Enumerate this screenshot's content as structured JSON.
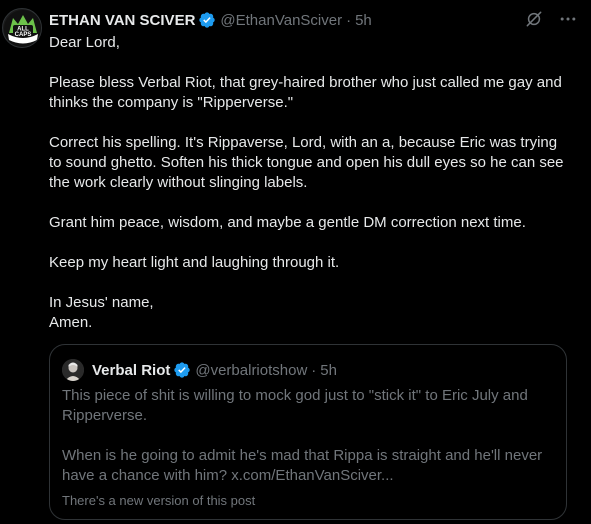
{
  "author": {
    "name": "ETHAN VAN SCIVER",
    "handle": "@EthanVanSciver",
    "separator": "·",
    "time": "5h",
    "avatar_icon": "all-caps-logo",
    "avatar_logo_text": "ALL CAPS"
  },
  "icons": {
    "grok": "grok-icon",
    "more": "more-icon",
    "verified": "verified-badge-icon"
  },
  "colors": {
    "background": "#000000",
    "text": "#e7e9ea",
    "muted": "#71767b",
    "verified": "#1d9bf0",
    "border": "#2f3336"
  },
  "post_body": {
    "p1": "Dear Lord,",
    "p2": "Please bless Verbal Riot, that grey-haired brother who just called me gay and thinks the company is \"Ripperverse.\"",
    "p3": "Correct his spelling.  It's Rippaverse, Lord, with an a, because Eric was trying to sound ghetto. Soften his thick tongue and open his dull eyes so he can see the work clearly without slinging labels.",
    "p4": "Grant him peace, wisdom, and maybe a gentle DM correction next time.",
    "p5": "Keep my heart light and laughing through it.",
    "p6_line1": "In Jesus' name,",
    "p6_line2": "Amen."
  },
  "quoted": {
    "name": "Verbal Riot",
    "handle": "@verbalriotshow",
    "separator": "·",
    "time": "5h",
    "body_p1": "This piece of shit is willing to mock god just to \"stick it\" to Eric July and Ripperverse.",
    "body_p2": "When is he going to admit he's mad that Rippa is straight and he'll never have a chance with him? x.com/EthanVanSciver...",
    "note": "There's a new version of this post"
  }
}
